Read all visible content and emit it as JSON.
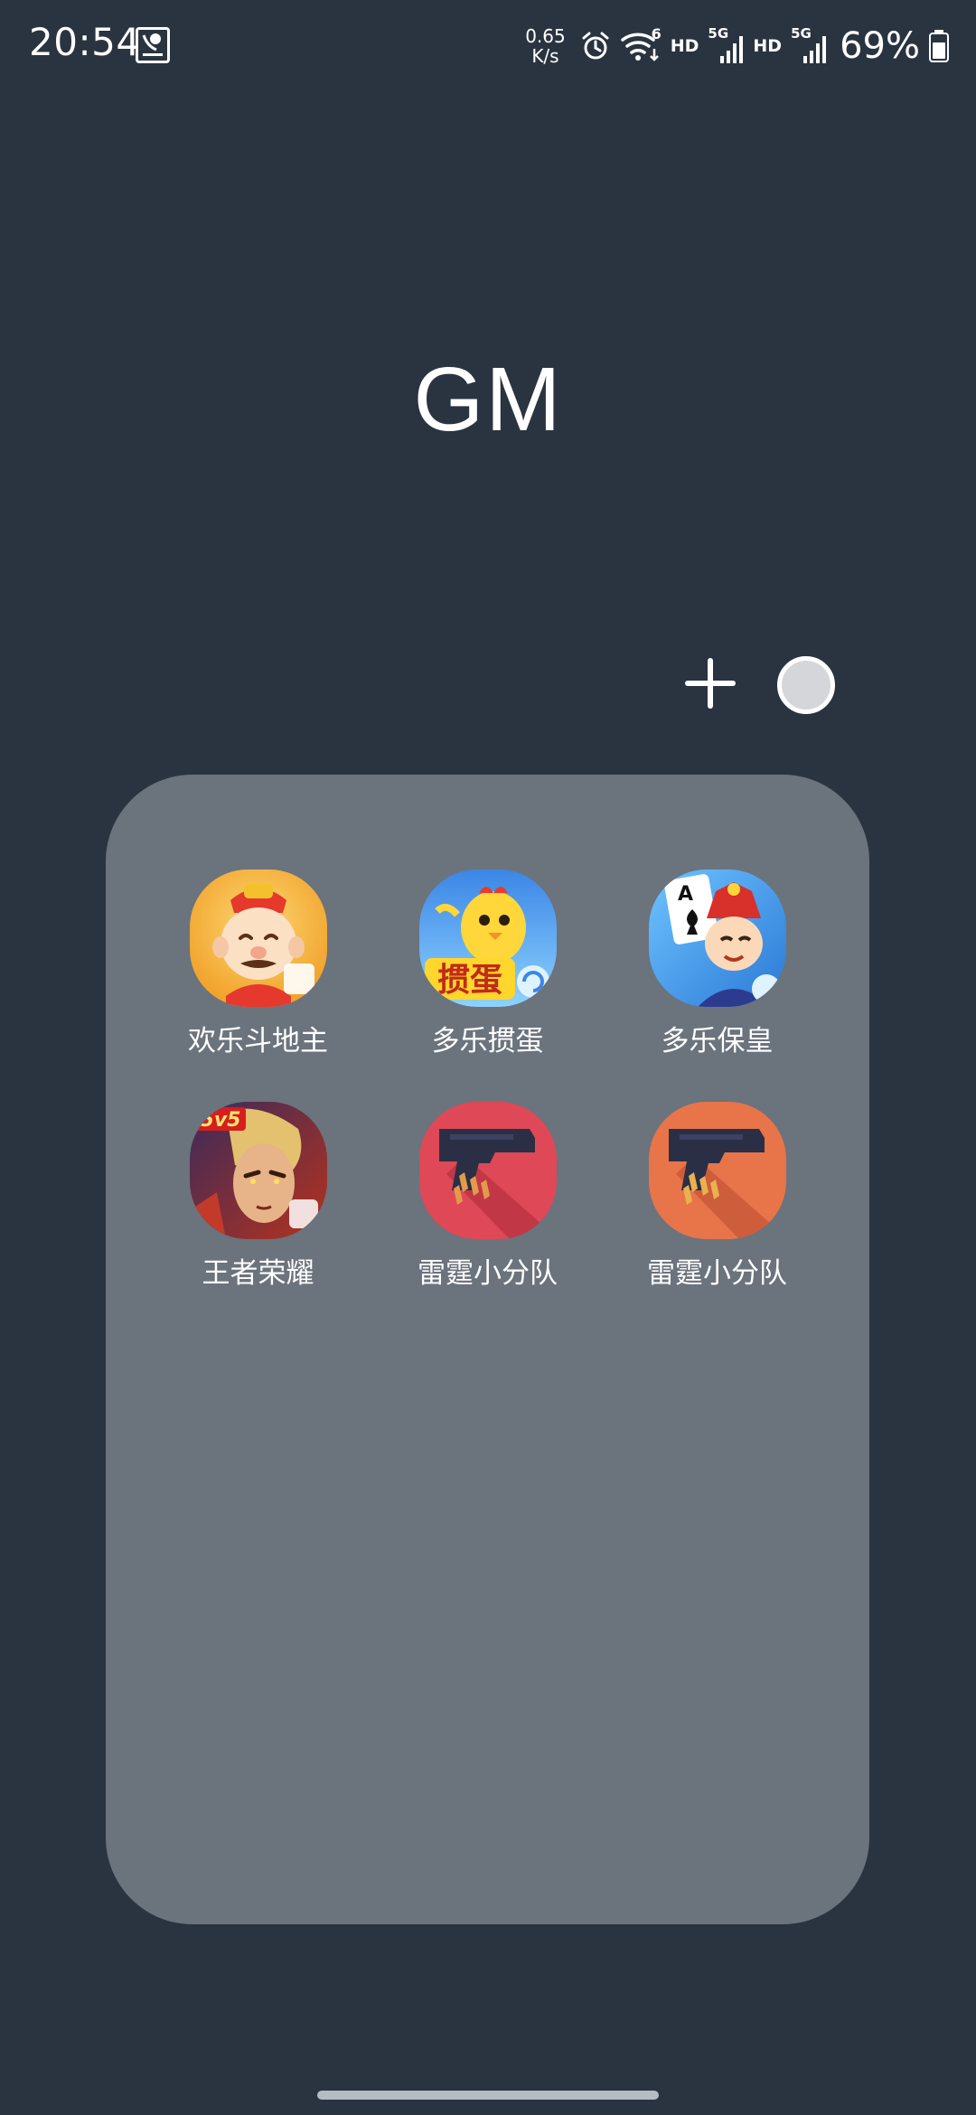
{
  "status_bar": {
    "time": "20:54",
    "net_speed_value": "0.65",
    "net_speed_unit": "K/s",
    "wifi_badge": "6",
    "hd1": "HD",
    "signal1": "5G",
    "hd2": "HD",
    "signal2": "5G",
    "battery": "69%",
    "icons": [
      "assistant-app-icon",
      "alarm-icon",
      "wifi-icon",
      "cellular-signal-icon",
      "battery-icon"
    ]
  },
  "folder": {
    "title": "GM",
    "apps": [
      {
        "label": "欢乐斗地主",
        "icon": "doudizhu-app-icon",
        "color": "#f2b233"
      },
      {
        "label": "多乐掼蛋",
        "icon": "guandan-app-icon",
        "color": "#3d8ff0"
      },
      {
        "label": "多乐保皇",
        "icon": "baohuang-app-icon",
        "color": "#3b9be8"
      },
      {
        "label": "王者荣耀",
        "icon": "honor-of-kings-app-icon",
        "color": "#7a2a1e"
      },
      {
        "label": "雷霆小分队",
        "icon": "thunder-squad-red-app-icon",
        "color": "#df4856"
      },
      {
        "label": "雷霆小分队",
        "icon": "thunder-squad-orange-app-icon",
        "color": "#e8744a"
      }
    ]
  },
  "colors": {
    "background": "#2a3441",
    "folder_panel": "#6b737d",
    "text": "#ffffff"
  }
}
